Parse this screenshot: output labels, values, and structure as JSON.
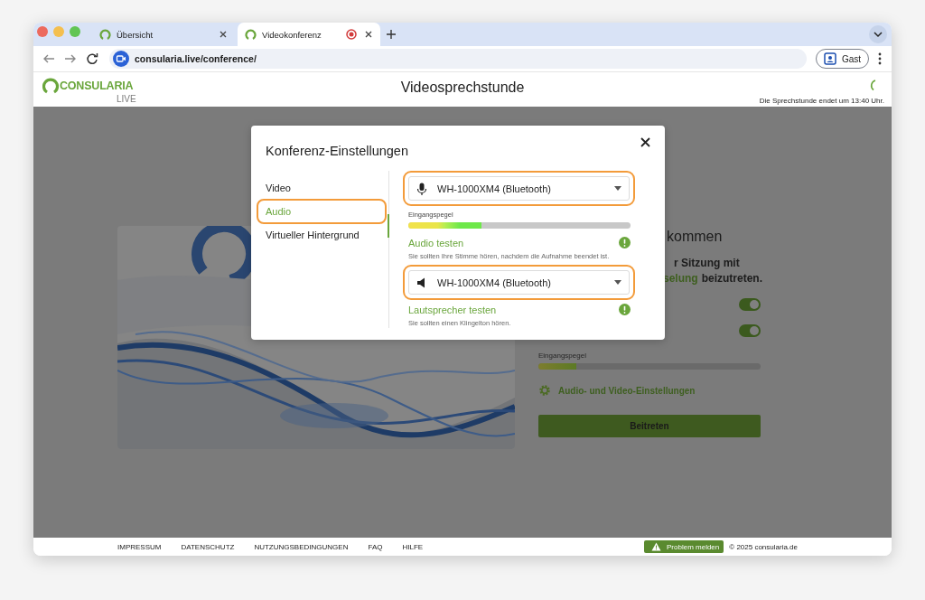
{
  "browser": {
    "tabs": [
      {
        "title": "Übersicht",
        "selected": false,
        "recording": false
      },
      {
        "title": "Videokonferenz",
        "selected": true,
        "recording": true
      }
    ],
    "url": "consularia.live/conference/",
    "profile": "Gast"
  },
  "header": {
    "logo": "CONSULARIA",
    "logo_sub": "LIVE",
    "title": "Videosprechstunde",
    "end_notice": "Die Sprechstunde endet um 13:40 Uhr."
  },
  "join_panel": {
    "heading": "kommen",
    "text_line1": "r Sitzung mit",
    "text_link": "selung",
    "text_rest": "beizutreten.",
    "toggles": [
      {
        "on": true
      },
      {
        "on": true
      }
    ],
    "level_label": "Eingangspegel",
    "level": 0.17,
    "settings_link": "Audio- und Video-Einstellungen",
    "join_button": "Beitreten"
  },
  "dialog": {
    "title": "Konferenz-Einstellungen",
    "nav": [
      {
        "label": "Video",
        "selected": false,
        "highlighted": false
      },
      {
        "label": "Audio",
        "selected": true,
        "highlighted": true
      },
      {
        "label": "Virtueller Hintergrund",
        "selected": false,
        "highlighted": false
      }
    ],
    "microphone": {
      "device": "WH-1000XM4 (Bluetooth)",
      "highlighted": true
    },
    "level_label": "Eingangspegel",
    "level": 0.33,
    "audio_test": {
      "label": "Audio testen",
      "hint": "Sie sollten Ihre Stimme hören, nachdem die Aufnahme beendet ist."
    },
    "speaker": {
      "device": "WH-1000XM4 (Bluetooth)",
      "highlighted": true
    },
    "speaker_test": {
      "label": "Lautsprecher testen",
      "hint": "Sie sollten einen Klingelton hören."
    }
  },
  "footer": {
    "links": [
      "IMPRESSUM",
      "DATENSCHUTZ",
      "NUTZUNGSBEDINGUNGEN",
      "FAQ",
      "HILFE"
    ],
    "report_button": "Problem melden",
    "copyright": "© 2025 consularia.de"
  }
}
